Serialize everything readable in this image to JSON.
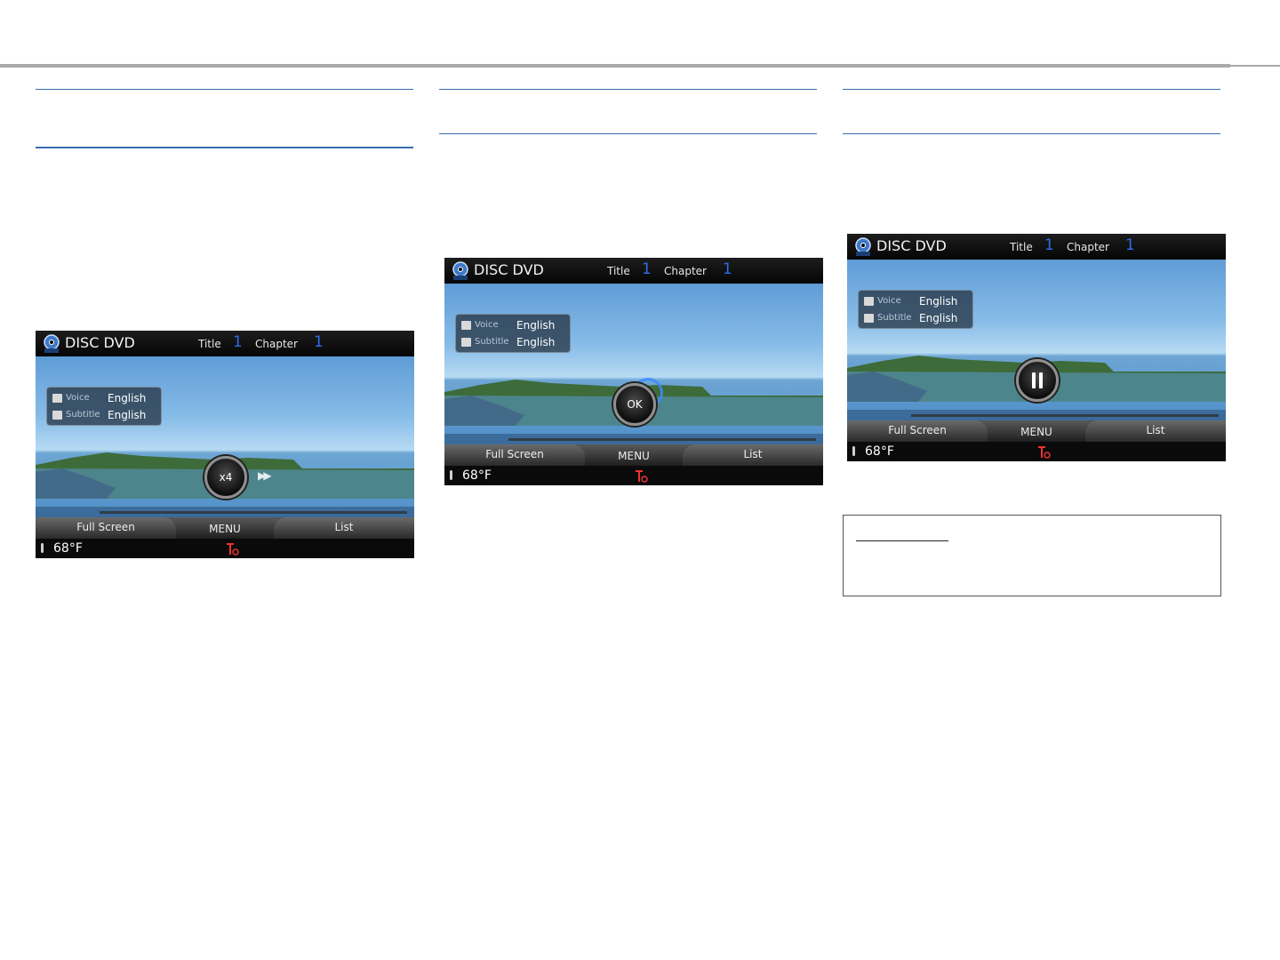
{
  "screens": [
    {
      "source": "DISC DVD",
      "title_label": "Title",
      "title_num": "1",
      "chapter_label": "Chapter",
      "chapter_num": "1",
      "voice_label": "Voice",
      "voice_value": "English",
      "subtitle_label": "Subtitle",
      "subtitle_value": "English",
      "control": "x4",
      "full_screen": "Full Screen",
      "menu": "MENU",
      "list": "List",
      "temperature": "68°F"
    },
    {
      "source": "DISC DVD",
      "title_label": "Title",
      "title_num": "1",
      "chapter_label": "Chapter",
      "chapter_num": "1",
      "voice_label": "Voice",
      "voice_value": "English",
      "subtitle_label": "Subtitle",
      "subtitle_value": "English",
      "control": "OK",
      "full_screen": "Full Screen",
      "menu": "MENU",
      "list": "List",
      "temperature": "68°F"
    },
    {
      "source": "DISC DVD",
      "title_label": "Title",
      "title_num": "1",
      "chapter_label": "Chapter",
      "chapter_num": "1",
      "voice_label": "Voice",
      "voice_value": "English",
      "subtitle_label": "Subtitle",
      "subtitle_value": "English",
      "full_screen": "Full Screen",
      "menu": "MENU",
      "list": "List",
      "temperature": "68°F"
    }
  ],
  "colors": {
    "chapter_number": "#2f6ce8",
    "rule_blue": "#3a6cb0",
    "rule_gray": "#a9a9a9"
  }
}
